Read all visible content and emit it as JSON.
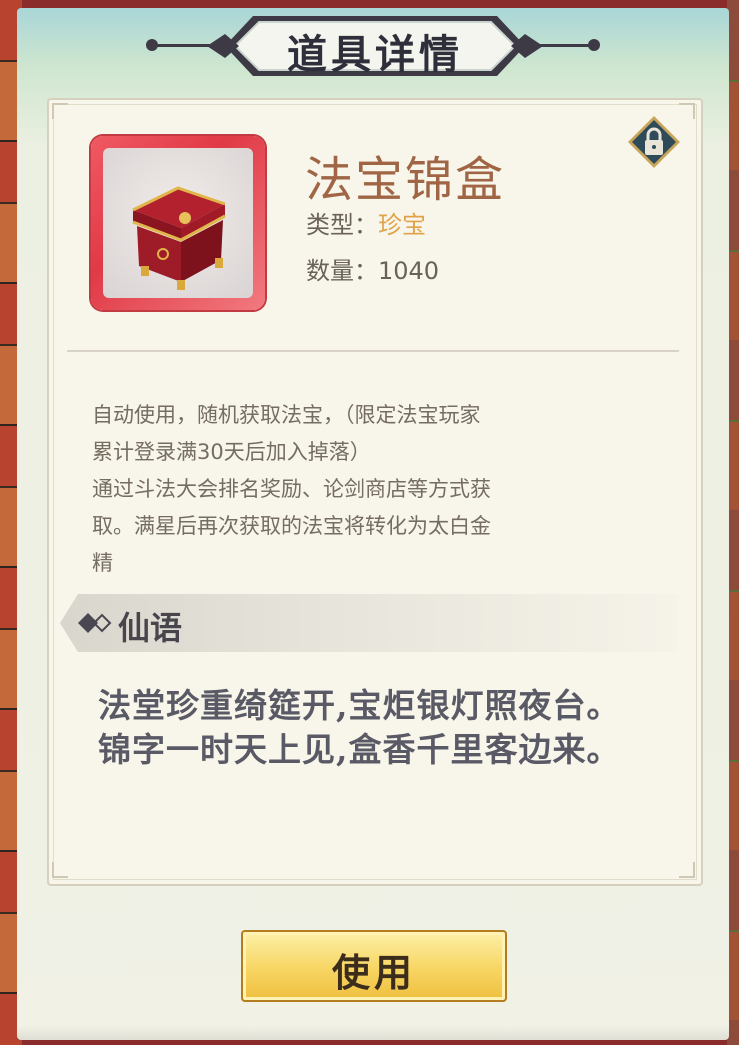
{
  "dialog": {
    "title": "道具详情"
  },
  "item": {
    "name": "法宝锦盒",
    "type_label": "类型：",
    "type_value": "珍宝",
    "quantity_label": "数量：",
    "quantity_value": "1040",
    "icon": "treasure-chest-icon",
    "locked": true
  },
  "description": {
    "lines": [
      "自动使用，随机获取法宝，（限定法宝玩家",
      "累计登录满30天后加入掉落）",
      "通过斗法大会排名奖励、论剑商店等方式获",
      "取。满星后再次获取的法宝将转化为太白金",
      "精"
    ]
  },
  "lore": {
    "section_title": "仙语",
    "poem_lines": [
      "法堂珍重绮筵开,宝炬银灯照夜台。",
      "锦字一时天上见,盒香千里客边来。"
    ]
  },
  "actions": {
    "use_label": "使用"
  },
  "colors": {
    "item_name": "#a06545",
    "type_value": "#e0a34a",
    "item_frame": "#e03a46",
    "button": "#f7d562"
  }
}
